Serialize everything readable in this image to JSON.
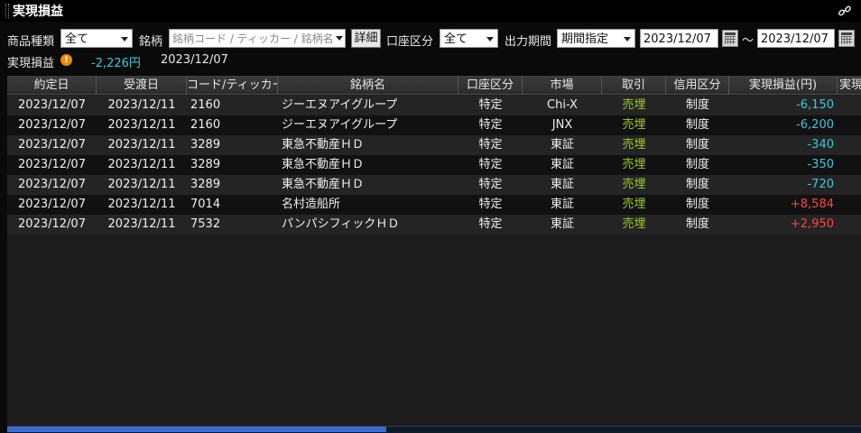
{
  "title": "実現損益",
  "filters": {
    "product_type_label": "商品種類",
    "product_type_value": "全て",
    "issue_label": "銘柄",
    "issue_placeholder": "銘柄コード / ティッカー / 銘柄名",
    "detail_button": "詳細",
    "account_type_label": "口座区分",
    "account_type_value": "全て",
    "period_label": "出力期間",
    "period_value": "期間指定",
    "date_from": "2023/12/07",
    "tilde": "～",
    "date_to": "2023/12/07"
  },
  "summary": {
    "label": "実現損益",
    "warning_glyph": "!",
    "value": "-2,226円",
    "date": "2023/12/07"
  },
  "table": {
    "headers": [
      "約定日",
      "受渡日",
      "コード/ティッカー",
      "銘柄名",
      "口座区分",
      "市場",
      "取引",
      "信用区分",
      "実現損益(円)",
      "実現"
    ],
    "rows": [
      {
        "trade_date": "2023/12/07",
        "settle_date": "2023/12/11",
        "code": "2160",
        "name": "ジーエヌアイグループ",
        "account": "特定",
        "market": "Chi-X",
        "trade": "売埋",
        "credit": "制度",
        "pl": "-6,150",
        "sign": "neg"
      },
      {
        "trade_date": "2023/12/07",
        "settle_date": "2023/12/11",
        "code": "2160",
        "name": "ジーエヌアイグループ",
        "account": "特定",
        "market": "JNX",
        "trade": "売埋",
        "credit": "制度",
        "pl": "-6,200",
        "sign": "neg"
      },
      {
        "trade_date": "2023/12/07",
        "settle_date": "2023/12/11",
        "code": "3289",
        "name": "東急不動産ＨＤ",
        "account": "特定",
        "market": "東証",
        "trade": "売埋",
        "credit": "制度",
        "pl": "-340",
        "sign": "neg"
      },
      {
        "trade_date": "2023/12/07",
        "settle_date": "2023/12/11",
        "code": "3289",
        "name": "東急不動産ＨＤ",
        "account": "特定",
        "market": "東証",
        "trade": "売埋",
        "credit": "制度",
        "pl": "-350",
        "sign": "neg"
      },
      {
        "trade_date": "2023/12/07",
        "settle_date": "2023/12/11",
        "code": "3289",
        "name": "東急不動産ＨＤ",
        "account": "特定",
        "market": "東証",
        "trade": "売埋",
        "credit": "制度",
        "pl": "-720",
        "sign": "neg"
      },
      {
        "trade_date": "2023/12/07",
        "settle_date": "2023/12/11",
        "code": "7014",
        "name": "名村造船所",
        "account": "特定",
        "market": "東証",
        "trade": "売埋",
        "credit": "制度",
        "pl": "+8,584",
        "sign": "pos"
      },
      {
        "trade_date": "2023/12/07",
        "settle_date": "2023/12/11",
        "code": "7532",
        "name": "パンパシフィックＨＤ",
        "account": "特定",
        "market": "東証",
        "trade": "売埋",
        "credit": "制度",
        "pl": "+2,950",
        "sign": "pos"
      }
    ]
  },
  "colors": {
    "negative": "#3cc8d8",
    "positive": "#ff4444",
    "trade_text": "#9ccc2c",
    "warning": "#f08a00"
  },
  "icons": {
    "link": "link-icon",
    "calendar": "calendar-icon",
    "warning": "warning-icon"
  }
}
